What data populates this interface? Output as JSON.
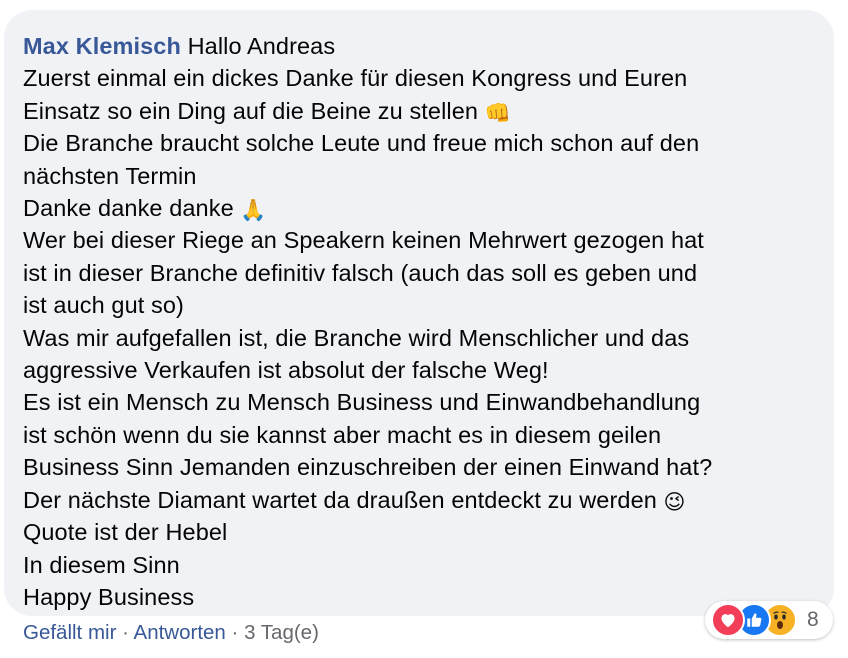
{
  "comment": {
    "author": "Max Klemisch",
    "first_line": "Hallo Andreas",
    "lines": [
      "Zuerst einmal ein dickes Danke für diesen Kongress und Euren",
      "Einsatz so ein Ding auf die Beine zu stellen",
      "Die Branche braucht solche Leute und freue mich schon auf den",
      "nächsten Termin",
      "Danke danke danke",
      "Wer bei dieser Riege an Speakern keinen Mehrwert gezogen hat",
      "ist in dieser Branche definitiv falsch (auch das soll es geben und",
      "ist auch gut so)",
      "Was mir aufgefallen ist, die Branche wird Menschlicher und das",
      "aggressive Verkaufen ist absolut der falsche Weg!",
      "Es ist ein Mensch zu Mensch Business und Einwandbehandlung",
      "ist schön wenn du sie kannst aber macht es in diesem geilen",
      "Business Sinn Jemanden einzuschreiben der einen Einwand hat?",
      "Der nächste Diamant wartet da draußen entdeckt zu werden",
      "Quote ist der Hebel",
      "In diesem Sinn",
      "Happy Business"
    ],
    "emojis": {
      "fist": "👊",
      "pray": "🙏",
      "wink": "😉"
    }
  },
  "reactions": {
    "icons": [
      "love-icon",
      "like-icon",
      "wow-icon"
    ],
    "count": "8",
    "colors": {
      "love": "#f33e58",
      "like": "#1877f2",
      "wow": "#f7b125"
    }
  },
  "footer": {
    "like_label": "Gefällt mir",
    "reply_label": "Antworten",
    "separator": "·",
    "time": "3 Tag(e)"
  }
}
